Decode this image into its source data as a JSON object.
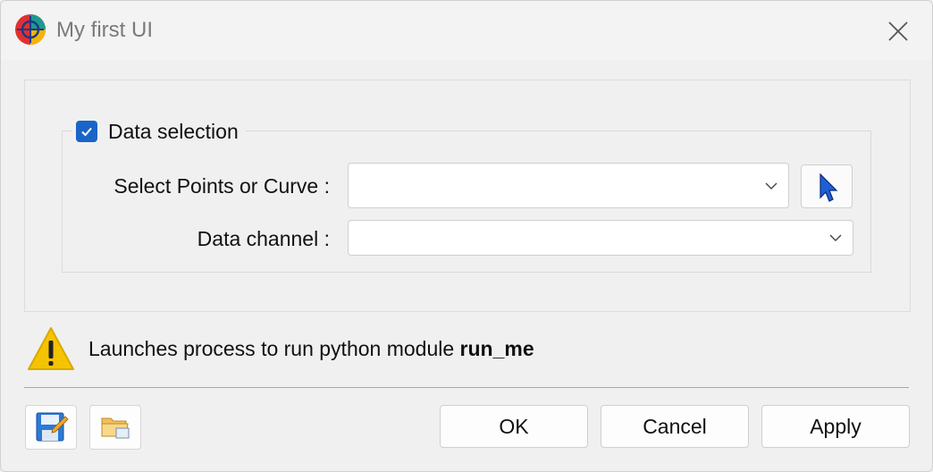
{
  "window": {
    "title": "My first UI",
    "icons": {
      "app": "app-target-icon",
      "close": "close-icon"
    }
  },
  "group": {
    "title": "Data selection",
    "checked": true,
    "fields": {
      "points_label": "Select Points or Curve :",
      "points_value": "",
      "channel_label": "Data channel :",
      "channel_value": ""
    },
    "pick_icon": "pointer-cursor-icon"
  },
  "warning": {
    "icon": "warning-icon",
    "text_prefix": "Launches process to run python module ",
    "module": "run_me"
  },
  "footer": {
    "save_icon": "save-floppy-icon",
    "open_icon": "open-folder-icon",
    "ok_label": "OK",
    "cancel_label": "Cancel",
    "apply_label": "Apply"
  },
  "colors": {
    "accent": "#1a64c8",
    "warning": "#f5c400"
  }
}
